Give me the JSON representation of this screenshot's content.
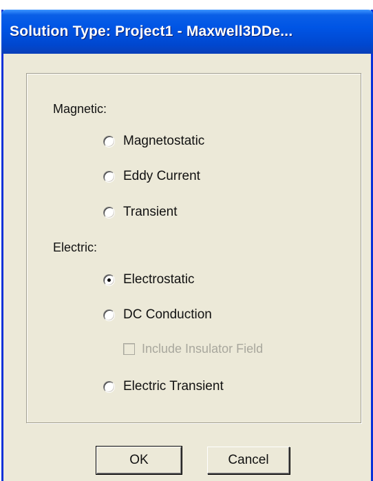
{
  "window": {
    "title": "Solution Type: Project1 - Maxwell3DDe..."
  },
  "magnetic": {
    "label": "Magnetic:",
    "options": [
      {
        "label": "Magnetostatic",
        "selected": false
      },
      {
        "label": "Eddy Current",
        "selected": false
      },
      {
        "label": "Transient",
        "selected": false
      }
    ]
  },
  "electric": {
    "label": "Electric:",
    "options": [
      {
        "label": "Electrostatic",
        "selected": true
      },
      {
        "label": "DC Conduction",
        "selected": false
      },
      {
        "label": "Electric Transient",
        "selected": false
      }
    ],
    "include_insulator": {
      "label": "Include Insulator Field",
      "checked": false,
      "enabled": false
    }
  },
  "buttons": {
    "ok_label": "OK",
    "cancel_label": "Cancel"
  }
}
